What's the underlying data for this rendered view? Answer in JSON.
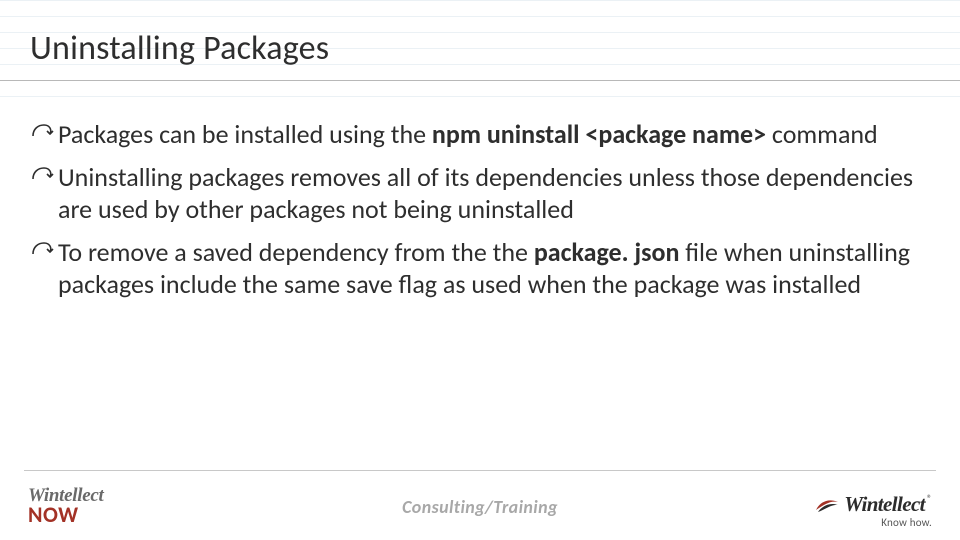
{
  "title": "Uninstalling Packages",
  "bullets": [
    {
      "pre": "Packages can be installed using the ",
      "b1": "npm uninstall <package name>",
      "post": " command"
    },
    {
      "pre": "Uninstalling packages removes all of its dependencies unless those dependencies are used by other packages not being uninstalled",
      "b1": "",
      "post": ""
    },
    {
      "pre": "To remove a saved dependency from the the ",
      "b1": "package. json",
      "post": " file when uninstalling packages include the same save flag as used when the package was installed"
    }
  ],
  "footer": {
    "left_line1": "Wintellect",
    "left_line2": "NOW",
    "center": "Consulting/Training",
    "right_brand": "Wintellect",
    "right_reg": "®",
    "right_tag": "Know how."
  }
}
